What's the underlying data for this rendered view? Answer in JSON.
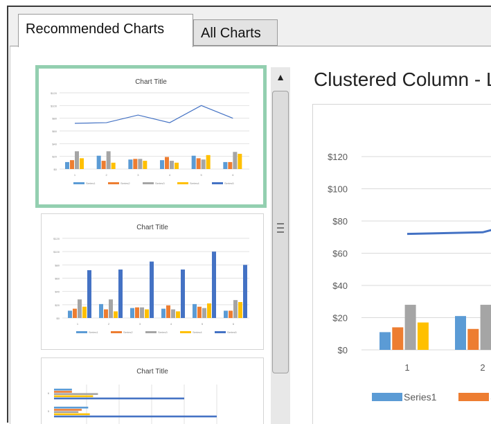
{
  "tabs": [
    {
      "label": "Recommended Charts",
      "selected": true
    },
    {
      "label": "All Charts",
      "selected": false
    }
  ],
  "preview": {
    "title": "Clustered Column - Line"
  },
  "thumbnails": [
    {
      "title": "Chart Title",
      "selected": true
    },
    {
      "title": "Chart Title",
      "selected": false
    },
    {
      "title": "Chart Title",
      "selected": false
    }
  ],
  "series_colors": [
    "#5b9bd5",
    "#ed7d31",
    "#a5a5a5",
    "#ffc000",
    "#4472c4"
  ],
  "chart_data": [
    {
      "type": "bar",
      "title": "Clustered Column - Line",
      "categories": [
        "1",
        "2",
        "3",
        "4",
        "5",
        "6"
      ],
      "y_tick_labels": [
        "$0",
        "$20",
        "$40",
        "$60",
        "$80",
        "$100",
        "$120"
      ],
      "ylim": [
        0,
        120
      ],
      "series": [
        {
          "name": "Series1",
          "kind": "column",
          "values": [
            11,
            21,
            15,
            14,
            21,
            11
          ]
        },
        {
          "name": "Series2",
          "kind": "column",
          "values": [
            14,
            13,
            16,
            19,
            17,
            11
          ]
        },
        {
          "name": "Series3",
          "kind": "column",
          "values": [
            28,
            28,
            16,
            13,
            15,
            27
          ]
        },
        {
          "name": "Series4",
          "kind": "column",
          "values": [
            17,
            10,
            13,
            10,
            22,
            24
          ]
        },
        {
          "name": "Series5",
          "kind": "line",
          "values": [
            72,
            73,
            85,
            73,
            100,
            80
          ]
        }
      ],
      "legend": "bottom",
      "grid": true
    }
  ]
}
